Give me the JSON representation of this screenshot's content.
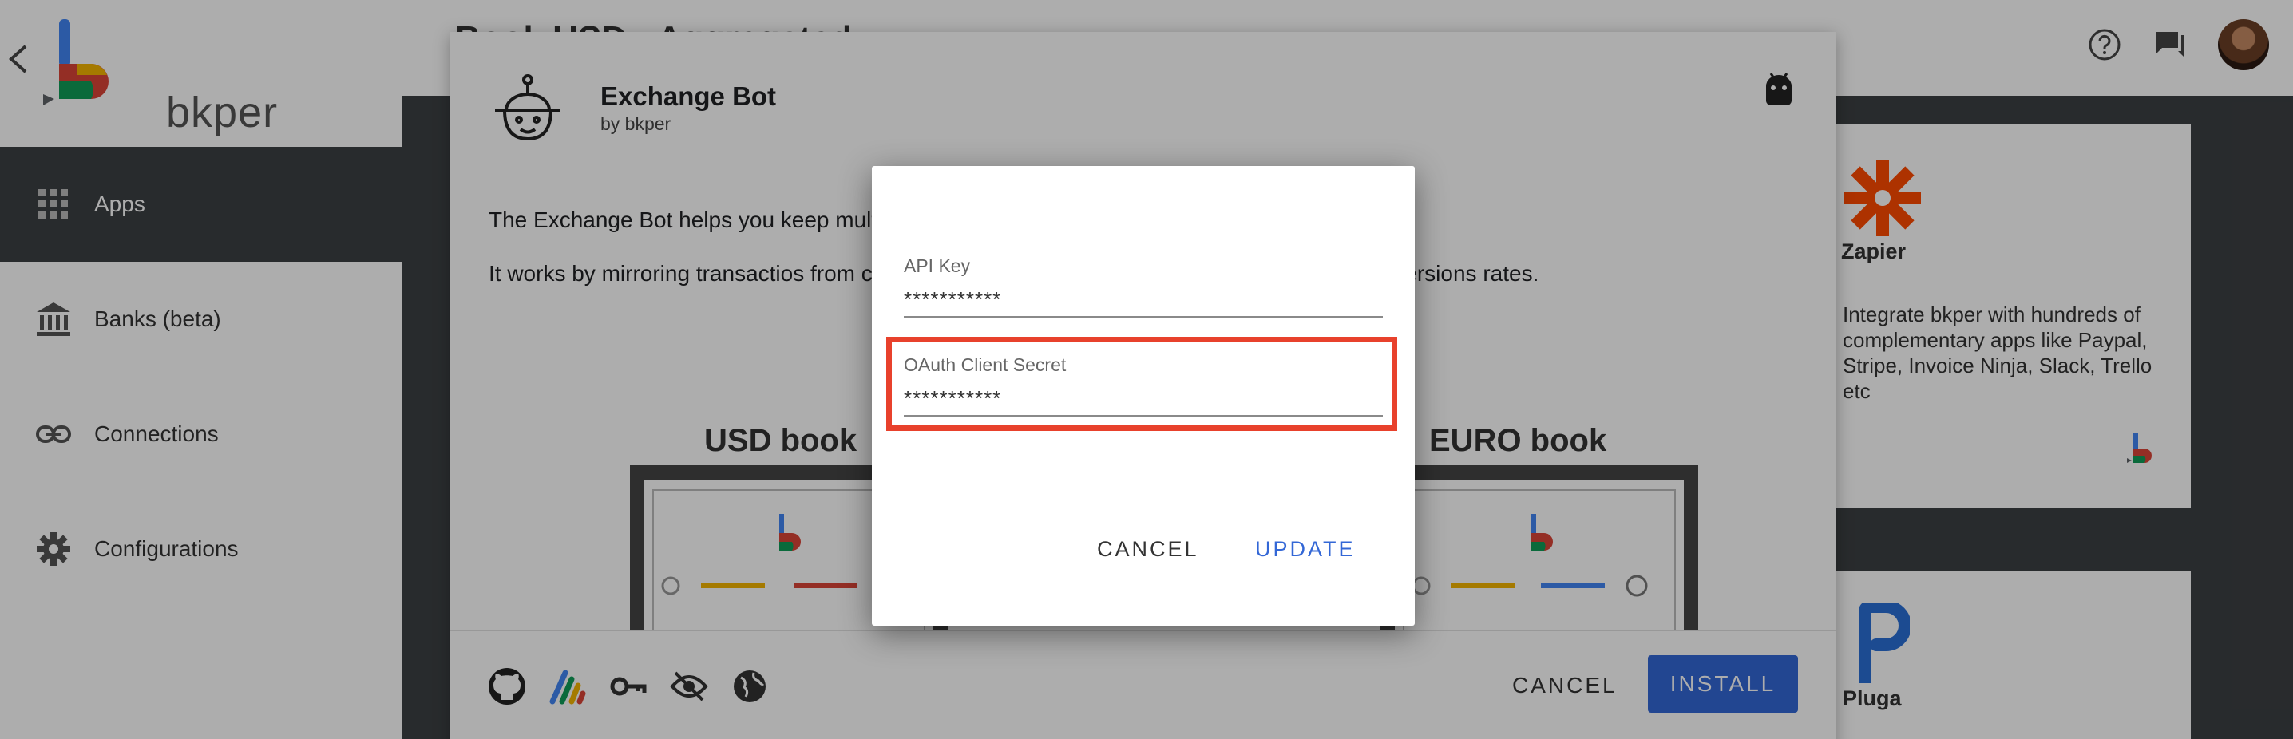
{
  "header": {
    "book_title": "Book USD · Aggregated",
    "logo_text": "bkper"
  },
  "sidebar": {
    "items": [
      {
        "label": "Apps",
        "icon": "apps-grid-icon",
        "active": true
      },
      {
        "label": "Banks (beta)",
        "icon": "bank-icon",
        "active": false
      },
      {
        "label": "Connections",
        "icon": "link-icon",
        "active": false
      },
      {
        "label": "Configurations",
        "icon": "gear-icon",
        "active": false
      }
    ]
  },
  "app_panel": {
    "title": "Exchange Bot",
    "author": "by bkper",
    "description_1": "The Exchange Bot helps you keep mult",
    "description_1_tail": "",
    "description_2": "It works by mirroring transactios from c",
    "description_2_tail": "d conversions rates.",
    "diagram": {
      "left_heading": "USD book",
      "right_heading": "EURO book"
    },
    "cancel_label": "CANCEL",
    "install_label": "INSTALL",
    "colors": {
      "install": "#3367d6"
    }
  },
  "side_cards": {
    "zapier": {
      "title": "Zapier",
      "description": "Integrate bkper with hundreds of complementary apps like Paypal, Stripe, Invoice Ninja, Slack, Trello etc"
    },
    "pluga": {
      "title": "Pluga"
    }
  },
  "dialog": {
    "fields": [
      {
        "label": "API Key",
        "value": "***********"
      },
      {
        "label": "OAuth Client Secret",
        "value": "***********"
      }
    ],
    "cancel_label": "CANCEL",
    "update_label": "UPDATE",
    "colors": {
      "highlight": "#e8412c",
      "primary": "#3367d6"
    }
  }
}
